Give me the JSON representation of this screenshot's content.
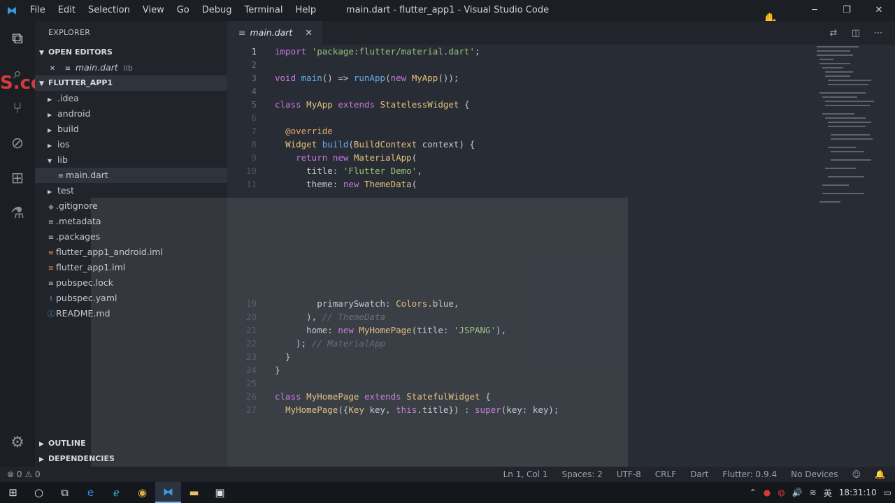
{
  "titlebar": {
    "menu": [
      "File",
      "Edit",
      "Selection",
      "View",
      "Go",
      "Debug",
      "Terminal",
      "Help"
    ],
    "title": "main.dart - flutter_app1 - Visual Studio Code"
  },
  "watermark": "S.com",
  "sidebar": {
    "heading": "EXPLORER",
    "open_editors_label": "OPEN EDITORS",
    "open_editor_file": "main.dart",
    "open_editor_hint": "lib",
    "project_label": "FLUTTER_APP1",
    "items": [
      {
        "label": ".idea"
      },
      {
        "label": "android"
      },
      {
        "label": "build"
      },
      {
        "label": "ios"
      },
      {
        "label": "lib"
      },
      {
        "label": "main.dart"
      },
      {
        "label": "test"
      },
      {
        "label": ".gitignore"
      },
      {
        "label": ".metadata"
      },
      {
        "label": ".packages"
      },
      {
        "label": "flutter_app1_android.iml"
      },
      {
        "label": "flutter_app1.iml"
      },
      {
        "label": "pubspec.lock"
      },
      {
        "label": "pubspec.yaml"
      },
      {
        "label": "README.md"
      }
    ],
    "outline_label": "OUTLINE",
    "dependencies_label": "DEPENDENCIES"
  },
  "editor": {
    "tab_label": "main.dart",
    "lines": [
      {
        "n": "1",
        "t": "import 'package:flutter/material.dart';"
      },
      {
        "n": "2",
        "t": ""
      },
      {
        "n": "3",
        "t": "void main() => runApp(new MyApp());"
      },
      {
        "n": "4",
        "t": ""
      },
      {
        "n": "5",
        "t": "class MyApp extends StatelessWidget {"
      },
      {
        "n": "6",
        "t": ""
      },
      {
        "n": "7",
        "t": "  @override"
      },
      {
        "n": "8",
        "t": "  Widget build(BuildContext context) {"
      },
      {
        "n": "9",
        "t": "    return new MaterialApp("
      },
      {
        "n": "10",
        "t": "      title: 'Flutter Demo',"
      },
      {
        "n": "11",
        "t": "      theme: new ThemeData("
      },
      {
        "n": "19",
        "t": "        primarySwatch: Colors.blue,"
      },
      {
        "n": "20",
        "t": "      ), // ThemeData"
      },
      {
        "n": "21",
        "t": "      home: new MyHomePage(title: 'JSPANG'),"
      },
      {
        "n": "22",
        "t": "    ); // MaterialApp"
      },
      {
        "n": "23",
        "t": "  }"
      },
      {
        "n": "24",
        "t": "}"
      },
      {
        "n": "25",
        "t": ""
      },
      {
        "n": "26",
        "t": "class MyHomePage extends StatefulWidget {"
      },
      {
        "n": "27",
        "t": "  MyHomePage({Key key, this.title}) : super(key: key);"
      }
    ]
  },
  "status": {
    "errors": "0",
    "warnings": "0",
    "position": "Ln 1, Col 1",
    "spaces": "Spaces: 2",
    "encoding": "UTF-8",
    "eol": "CRLF",
    "language": "Dart",
    "sdk": "Flutter: 0.9.4",
    "devices": "No Devices"
  },
  "taskbar": {
    "time": "18:31:10",
    "ime": "英"
  }
}
